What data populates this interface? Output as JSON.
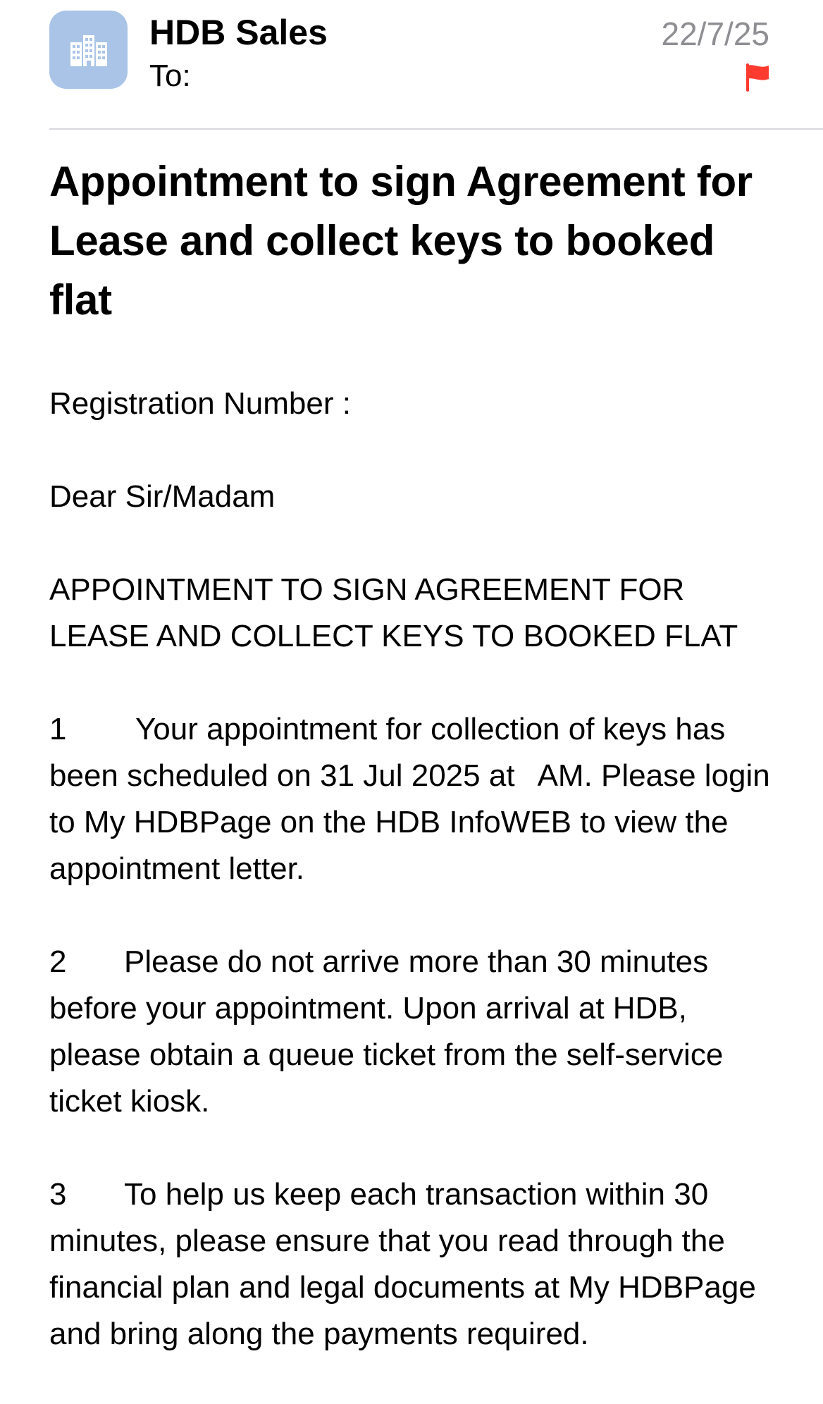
{
  "header": {
    "sender": "HDB Sales",
    "to_label": "To:",
    "to_value": "",
    "date": "22/7/25",
    "flagged": true,
    "flag_color": "#ff3b30",
    "avatar_icon": "building-icon",
    "avatar_color": "#a9c4e6"
  },
  "email": {
    "subject": "Appointment to sign Agreement for Lease and collect keys to booked flat",
    "registration_label": "Registration Number :",
    "registration_value": "",
    "greeting": "Dear Sir/Madam",
    "heading_line1": "APPOINTMENT TO SIGN AGREEMENT FOR",
    "heading_line2": "LEASE AND COLLECT KEYS TO BOOKED FLAT",
    "paragraphs": [
      {
        "number": "1",
        "text_before": "Your appointment for collection of keys has been scheduled on 31 Jul 2025 at",
        "text_after": "AM. Please login to My HDBPage on the HDB InfoWEB to view the appointment letter."
      },
      {
        "number": "2",
        "text": "Please do not arrive more than 30 minutes before your appointment. Upon arrival at HDB, please obtain a queue ticket from the self-service ticket kiosk."
      },
      {
        "number": "3",
        "text": "To help us keep each transaction within 30 minutes, please ensure that you read through the financial plan and legal documents at My HDBPage and bring along the payments required."
      }
    ]
  }
}
